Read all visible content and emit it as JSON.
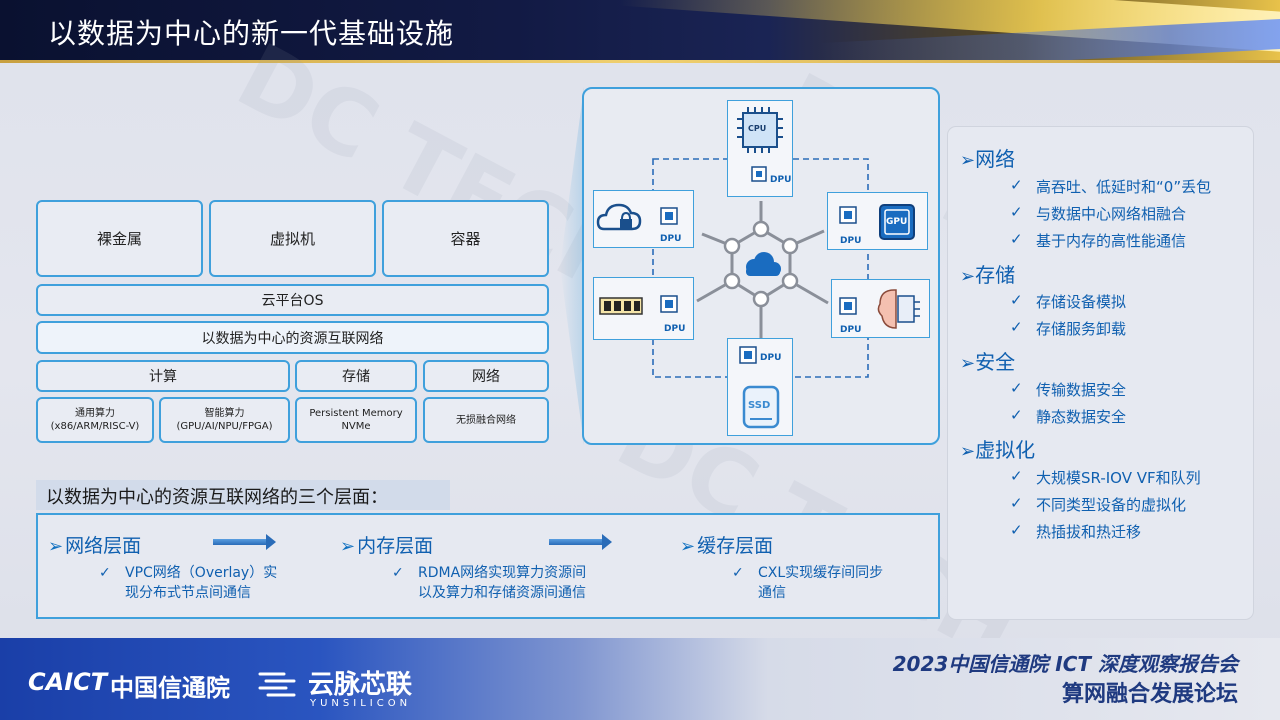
{
  "header": {
    "title": "以数据为中心的新一代基础设施"
  },
  "watermark": "DC TECH",
  "arch": {
    "top": [
      "裸金属",
      "虚拟机",
      "容器"
    ],
    "cloud_os": "云平台OS",
    "network": "以数据为中心的资源互联网络",
    "mid": [
      "计算",
      "存储",
      "网络"
    ],
    "bottom": [
      {
        "l1": "通用算力",
        "l2": "(x86/ARM/RISC-V)"
      },
      {
        "l1": "智能算力",
        "l2": "(GPU/AI/NPU/FPGA)"
      },
      {
        "l1": "Persistent Memory",
        "l2": "NVMe"
      },
      {
        "l1": "无损融合网络",
        "l2": ""
      }
    ]
  },
  "layers": {
    "title": "以数据为中心的资源互联网络的三个层面：",
    "items": [
      {
        "head": "网络层面",
        "l1": "VPC网络（Overlay）实",
        "l2": "现分布式节点间通信"
      },
      {
        "head": "内存层面",
        "l1": "RDMA网络实现算力资源间",
        "l2": "以及算力和存储资源间通信"
      },
      {
        "head": "缓存层面",
        "l1": "CXL实现缓存间同步",
        "l2": "通信"
      }
    ]
  },
  "diagram": {
    "dpu": "DPU",
    "cpu": "CPU",
    "gpu": "GPU",
    "ssd": "SSD"
  },
  "features": [
    {
      "head": "网络",
      "items": [
        "高吞吐、低延时和“0”丢包",
        "与数据中心网络相融合",
        "基于内存的高性能通信"
      ]
    },
    {
      "head": "存储",
      "items": [
        "存储设备模拟",
        "存储服务卸载"
      ]
    },
    {
      "head": "安全",
      "items": [
        "传输数据安全",
        "静态数据安全"
      ]
    },
    {
      "head": "虚拟化",
      "items": [
        "大规模SR-IOV VF和队列",
        "不同类型设备的虚拟化",
        "热插拔和热迁移"
      ]
    }
  ],
  "symbols": {
    "chevron": "➢",
    "check": "✓"
  },
  "footer": {
    "caict_en": "CAICT",
    "caict_cn": "中国信通院",
    "yun_cn": "云脉芯联",
    "yun_en": "YUNSILICON",
    "event_line1": "2023中国信通院 ICT 深度观察报告会",
    "event_line2": "算网融合发展论坛"
  },
  "colors": {
    "accent": "#1060b0",
    "border": "#3fa0dc",
    "header_bg": "#0a1130"
  }
}
